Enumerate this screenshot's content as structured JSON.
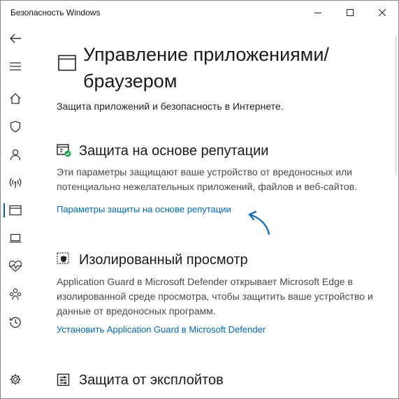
{
  "window": {
    "title": "Безопасность Windows"
  },
  "titlebar_buttons": [
    "minimize-icon",
    "maximize-icon",
    "close-icon"
  ],
  "sidebar": {
    "items": [
      {
        "name": "back",
        "icon": "back-arrow-icon"
      },
      {
        "name": "menu",
        "icon": "hamburger-menu-icon"
      },
      {
        "name": "home",
        "icon": "home-icon"
      },
      {
        "name": "virus-protection",
        "icon": "shield-icon"
      },
      {
        "name": "account-protection",
        "icon": "person-icon"
      },
      {
        "name": "firewall",
        "icon": "wireless-signal-icon"
      },
      {
        "name": "app-browser-control",
        "icon": "app-window-icon",
        "active": true
      },
      {
        "name": "device-security",
        "icon": "laptop-icon"
      },
      {
        "name": "device-performance",
        "icon": "heart-pulse-icon"
      },
      {
        "name": "family-options",
        "icon": "family-icon"
      },
      {
        "name": "protection-history",
        "icon": "history-icon"
      },
      {
        "name": "settings",
        "icon": "gear-icon"
      }
    ]
  },
  "page": {
    "title": "Управление приложениями/ браузером",
    "subtitle": "Защита приложений и безопасность в Интернете."
  },
  "sections": [
    {
      "title": "Защита на основе репутации",
      "icon": "reputation-shield-icon",
      "description": "Эти параметры защищают ваше устройство от вредоносных или потенциально нежелательных приложений, файлов и веб-сайтов.",
      "link": "Параметры защиты на основе репутации"
    },
    {
      "title": "Изолированный просмотр",
      "icon": "isolated-browsing-icon",
      "description": "Application Guard в Microsoft Defender открывает Microsoft Edge в изолированной среде просмотра, чтобы защитить ваше устройство и данные от вредоносных программ.",
      "link": "Установить Application Guard в Microsoft Defender"
    },
    {
      "title": "Защита от эксплойтов",
      "icon": "exploit-protection-icon"
    }
  ],
  "colors": {
    "accent": "#0067c0",
    "status_ok": "#16a34a",
    "annotation_arrow": "#1e6fb8"
  }
}
